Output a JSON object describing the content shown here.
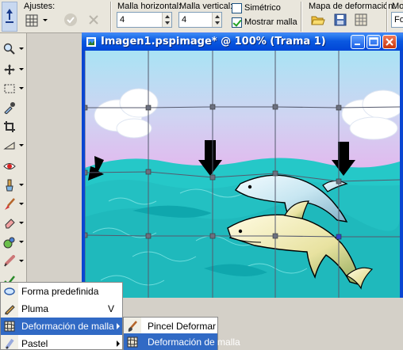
{
  "options_bar": {
    "ajustes_label": "Ajustes:",
    "malla_horizontal": {
      "label": "Malla horizontal:",
      "value": "4"
    },
    "malla_vertical": {
      "label": "Malla vertical:",
      "value": "4"
    },
    "simetrico": {
      "label": "Simétrico",
      "checked": false
    },
    "mostrar_malla": {
      "label": "Mostrar malla",
      "checked": true
    },
    "mapa_label": "Mapa de deformación:",
    "modo_label": "Mo",
    "modo_value": "Fo"
  },
  "document": {
    "title": "Imagen1.pspimage* @ 100% (Trama 1)",
    "colors": {
      "sky_top": "#b9e8f6",
      "sky_bottom": "#d9b8ee",
      "sea": "#25c8c8",
      "wave_dark": "#0fa7ad",
      "grid": "#555a6e"
    }
  },
  "tools": [
    "zoom-icon",
    "move-icon",
    "selection-icon",
    "eyedropper-icon",
    "crop-icon",
    "straighten-icon",
    "red-eye-icon",
    "clone-icon",
    "brush-icon",
    "eraser-icon",
    "airbrush-icon",
    "smudge-icon",
    "retouch-icon",
    "checkmark-icon"
  ],
  "menu": {
    "items": [
      {
        "label": "Forma predefinida",
        "shortcut": ""
      },
      {
        "label": "Pluma",
        "shortcut": "V"
      },
      {
        "label": "Deformación de malla",
        "shortcut": ""
      },
      {
        "label": "Pastel",
        "shortcut": ""
      }
    ]
  },
  "submenu": {
    "items": [
      {
        "label": "Pincel Deformar"
      },
      {
        "label": "Deformación de malla"
      }
    ]
  }
}
